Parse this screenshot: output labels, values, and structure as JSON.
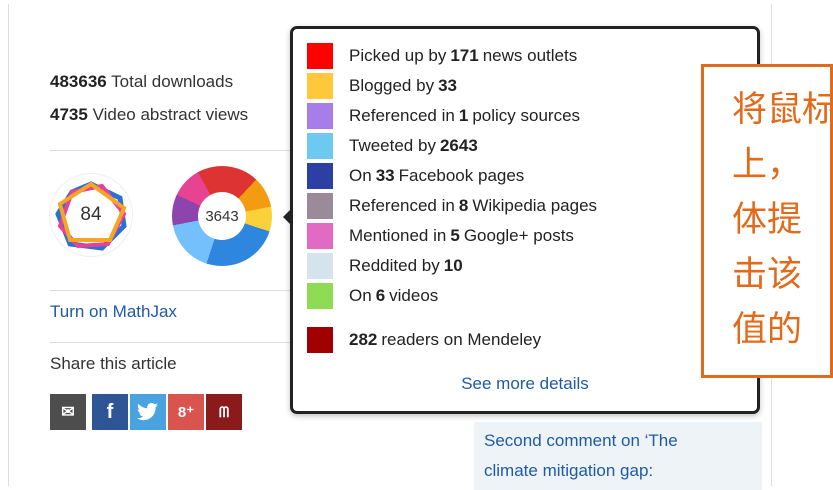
{
  "stats": {
    "downloads_value": "483636",
    "downloads_label": "Total downloads",
    "video_value": "4735",
    "video_label": "Video abstract views"
  },
  "badges": {
    "dimensions_score": "84",
    "altmetric_score": "3643"
  },
  "links": {
    "mathjax": "Turn on MathJax",
    "share_label": "Share this article"
  },
  "share_buttons": [
    {
      "name": "email",
      "glyph": "✉"
    },
    {
      "name": "facebook",
      "glyph": "f"
    },
    {
      "name": "twitter",
      "glyph": ""
    },
    {
      "name": "google-plus",
      "glyph": "8⁺"
    },
    {
      "name": "mendeley",
      "glyph": "ᗰ"
    }
  ],
  "comment": {
    "line1": "Second comment on ‘The",
    "line2": "climate mitigation gap:"
  },
  "popup": {
    "rows": [
      {
        "color": "#ff0000",
        "pre": "Picked up by",
        "value": "171",
        "post": "news outlets"
      },
      {
        "color": "#ffc83a",
        "pre": "Blogged by",
        "value": "33",
        "post": ""
      },
      {
        "color": "#a77ee8",
        "pre": "Referenced in",
        "value": "1",
        "post": "policy sources"
      },
      {
        "color": "#6fc8f0",
        "pre": "Tweeted by",
        "value": "2643",
        "post": ""
      },
      {
        "color": "#2b3fa4",
        "pre": "On",
        "value": "33",
        "post": "Facebook pages"
      },
      {
        "color": "#9b8a9a",
        "pre": "Referenced in",
        "value": "8",
        "post": "Wikipedia pages"
      },
      {
        "color": "#e26ac4",
        "pre": "Mentioned in",
        "value": "5",
        "post": "Google+ posts"
      },
      {
        "color": "#d3e4ee",
        "pre": "Reddited by",
        "value": "10",
        "post": ""
      },
      {
        "color": "#8fdc54",
        "pre": "On",
        "value": "6",
        "post": "videos"
      },
      {
        "color": "#a00000",
        "pre": "",
        "value": "282",
        "post": "readers on Mendeley"
      }
    ],
    "see_more": "See more details"
  },
  "callout": {
    "lines": [
      "将鼠标",
      "上，",
      "体提",
      "击该",
      "值的"
    ]
  },
  "colors": {
    "link": "#1f5aa6",
    "callout": "#e26a1b"
  }
}
